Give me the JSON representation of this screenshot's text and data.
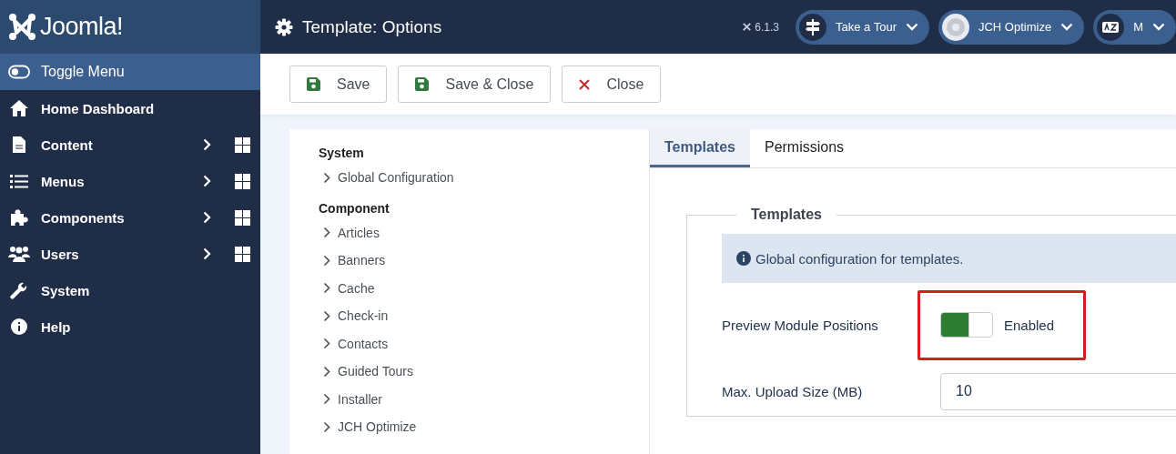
{
  "brand": {
    "name": "Joomla!"
  },
  "header": {
    "title": "Template: Options",
    "version": "6.1.3",
    "menus": [
      {
        "label": "Take a Tour",
        "kind": "tour"
      },
      {
        "label": "JCH Optimize",
        "kind": "jch"
      },
      {
        "label": "M",
        "kind": "language"
      }
    ]
  },
  "sidebar": {
    "items": [
      {
        "label": "Toggle Menu",
        "kind": "toggle",
        "has_submenu": false
      },
      {
        "label": "Home Dashboard",
        "kind": "home",
        "has_submenu": false
      },
      {
        "label": "Content",
        "kind": "content",
        "has_submenu": true
      },
      {
        "label": "Menus",
        "kind": "menus",
        "has_submenu": true
      },
      {
        "label": "Components",
        "kind": "components",
        "has_submenu": true
      },
      {
        "label": "Users",
        "kind": "users",
        "has_submenu": true
      },
      {
        "label": "System",
        "kind": "system",
        "has_submenu": false
      },
      {
        "label": "Help",
        "kind": "help",
        "has_submenu": false
      }
    ]
  },
  "toolbar": {
    "buttons": [
      {
        "label": "Save",
        "kind": "save"
      },
      {
        "label": "Save & Close",
        "kind": "save"
      },
      {
        "label": "Close",
        "kind": "close"
      }
    ]
  },
  "options_nav": {
    "sections": [
      {
        "heading": "System",
        "items": [
          "Global Configuration"
        ]
      },
      {
        "heading": "Component",
        "items": [
          "Articles",
          "Banners",
          "Cache",
          "Check-in",
          "Contacts",
          "Guided Tours",
          "Installer",
          "JCH Optimize"
        ]
      }
    ]
  },
  "tabs": [
    {
      "label": "Templates",
      "selected": true
    },
    {
      "label": "Permissions",
      "selected": false
    }
  ],
  "fieldset": {
    "legend": "Templates",
    "info": "Global configuration for templates.",
    "fields": [
      {
        "kind": "switch",
        "label": "Preview Module Positions",
        "on": true,
        "state_label": "Enabled",
        "highlighted": true
      },
      {
        "kind": "text",
        "label": "Max. Upload Size (MB)",
        "value": "10"
      }
    ]
  }
}
